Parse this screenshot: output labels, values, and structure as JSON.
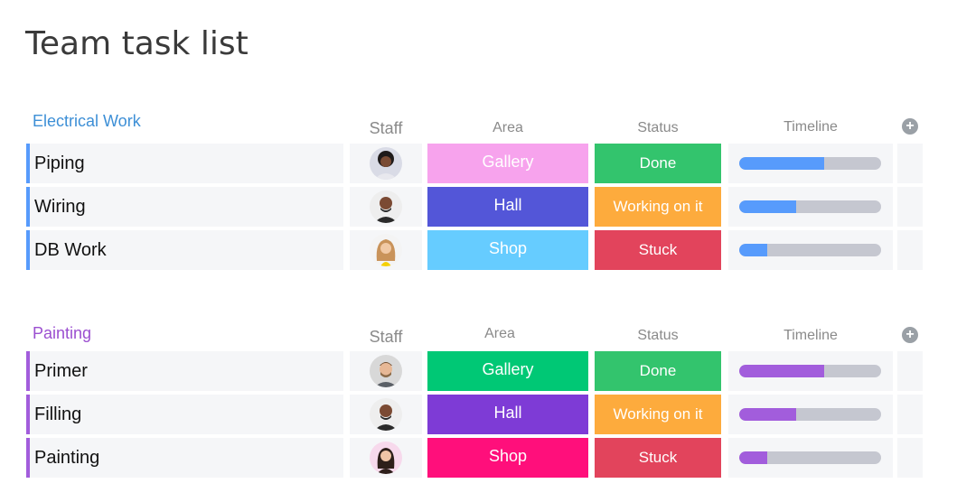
{
  "page": {
    "title": "Team task list"
  },
  "columns": {
    "staff": "Staff",
    "area": "Area",
    "status": "Status",
    "timeline": "Timeline",
    "add": "+"
  },
  "groups": [
    {
      "name": "Electrical Work",
      "color": "#579bfc",
      "title_color": "#3d8fd6",
      "rows": [
        {
          "name": "Piping",
          "area": "Gallery",
          "area_color": "#f7a3ed",
          "status": "Done",
          "status_color": "#33c46d",
          "progress": 0.6
        },
        {
          "name": "Wiring",
          "area": "Hall",
          "area_color": "#5356d8",
          "status": "Working on it",
          "status_color": "#fdab3d",
          "progress": 0.4
        },
        {
          "name": "DB Work",
          "area": "Shop",
          "area_color": "#66ccff",
          "status": "Stuck",
          "status_color": "#e2445c",
          "progress": 0.2
        }
      ]
    },
    {
      "name": "Painting",
      "color": "#a25ddc",
      "title_color": "#9b4fd0",
      "rows": [
        {
          "name": "Primer",
          "area": "Gallery",
          "area_color": "#00c875",
          "status": "Done",
          "status_color": "#33c46d",
          "progress": 0.6
        },
        {
          "name": "Filling",
          "area": "Hall",
          "area_color": "#7e3bd6",
          "status": "Working on it",
          "status_color": "#fdab3d",
          "progress": 0.4
        },
        {
          "name": "Painting",
          "area": "Shop",
          "area_color": "#ff0f7b",
          "status": "Stuck",
          "status_color": "#e2445c",
          "progress": 0.2
        }
      ]
    }
  ]
}
